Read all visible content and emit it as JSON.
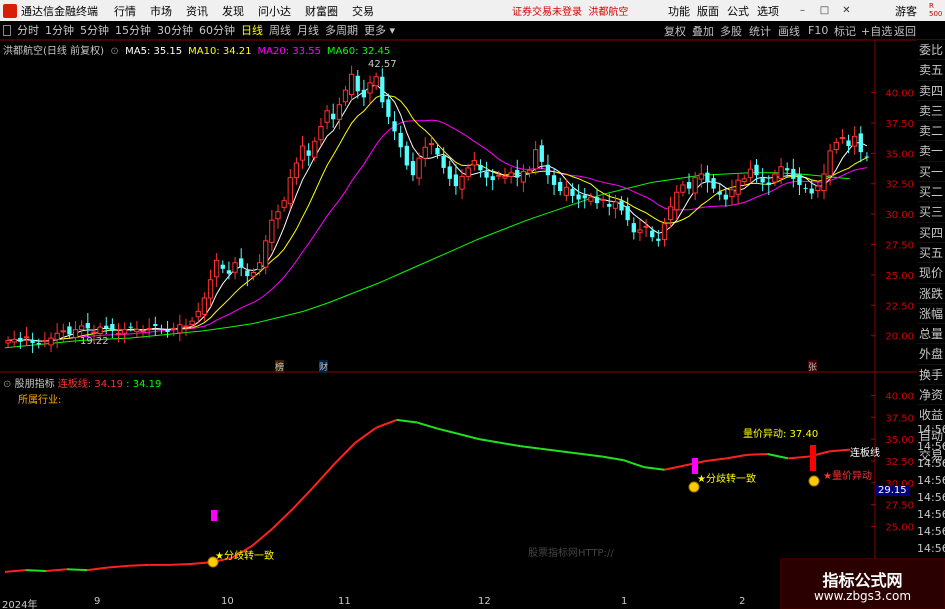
{
  "titlebar": {
    "app": "通达信金融终端",
    "menus": [
      "行情",
      "市场",
      "资讯",
      "发现",
      "问小达",
      "财富圈",
      "交易"
    ],
    "notice": "证券交易未登录",
    "stock": "洪都航空",
    "right_menus": [
      "功能",
      "版面",
      "公式",
      "选项"
    ],
    "user": "游客"
  },
  "toolbar": {
    "periods": [
      "分时",
      "1分钟",
      "5分钟",
      "15分钟",
      "30分钟",
      "60分钟",
      "日线",
      "周线",
      "月线",
      "多周期",
      "更多"
    ],
    "active_period": "日线",
    "right_buttons": [
      "复权",
      "叠加",
      "多股",
      "统计",
      "画线",
      "F10",
      "标记",
      "+自选",
      "返回"
    ]
  },
  "main": {
    "title": "洪都航空(日线 前复权)",
    "ma": [
      {
        "label": "MA5: 35.15",
        "color": "#ffffff"
      },
      {
        "label": "MA10: 34.21",
        "color": "#ffff00"
      },
      {
        "label": "MA20: 33.55",
        "color": "#ff00ff"
      },
      {
        "label": "MA60: 32.45",
        "color": "#00ff00"
      }
    ],
    "yticks": [
      "40.00",
      "37.50",
      "35.00",
      "32.50",
      "30.00",
      "27.50",
      "25.00",
      "22.50",
      "20.00"
    ],
    "high_label": "42.57",
    "low_label": "19.22",
    "markers": [
      {
        "text": "榜",
        "color": "#ffaa00"
      },
      {
        "text": "财",
        "color": "#00aaff"
      },
      {
        "text": "张",
        "color": "#ff4444"
      }
    ]
  },
  "sidebar": [
    "委比",
    "卖五",
    "卖四",
    "卖三",
    "卖二",
    "卖一",
    "买一",
    "买二",
    "买三",
    "买四",
    "买五",
    "现价",
    "涨跌",
    "涨幅",
    "总量",
    "外盘",
    "换手",
    "净资",
    "收益",
    "自动",
    "交易"
  ],
  "sidebar_times": [
    "14:56",
    "14:56",
    "14:56",
    "14:56",
    "14:56",
    "14:56",
    "14:56",
    "14:56"
  ],
  "indicator": {
    "name": "股朋指标",
    "line_label": "连板线:",
    "line_value": "34.19",
    "line_value2": ": 34.19",
    "industry": "所属行业:",
    "vol_text": "量价异动: 37.40",
    "yticks": [
      "40.00",
      "37.50",
      "35.00",
      "32.50",
      "30.00",
      "27.50",
      "25.00"
    ],
    "current_value": "29.15",
    "signals": [
      "分歧转一致",
      "分歧转一致",
      "量价异动"
    ],
    "line_tag": "连板线",
    "faint_text": "股票指标网HTTP://"
  },
  "xaxis": [
    "2024年",
    "9",
    "10",
    "11",
    "12",
    "1",
    "2"
  ],
  "watermark": {
    "title": "指标公式网",
    "url": "www.zbgs3.com"
  },
  "colors": {
    "up": "#ff3232",
    "down": "#54ffff",
    "ma5": "#ffffff",
    "ma10": "#ffff00",
    "ma20": "#ff00ff",
    "ma60": "#00ff00",
    "grid": "#7a0000"
  },
  "chart_data": {
    "type": "candlestick",
    "closes": [
      19.6,
      19.7,
      19.5,
      19.9,
      19.4,
      19.3,
      19.6,
      19.8,
      20.2,
      20.4,
      20.1,
      20.5,
      20.8,
      20.6,
      20.3,
      20.7,
      20.6,
      20.4,
      20.2,
      20.5,
      20.7,
      20.5,
      20.4,
      20.6,
      20.8,
      20.5,
      20.3,
      20.6,
      20.9,
      20.8,
      21.2,
      22.0,
      23.1,
      24.6,
      26.2,
      25.5,
      25.1,
      26.0,
      25.6,
      24.9,
      25.2,
      26.0,
      27.8,
      29.5,
      30.2,
      31.1,
      33.0,
      34.2,
      35.6,
      34.8,
      36.0,
      37.2,
      38.5,
      37.8,
      39.0,
      40.2,
      41.5,
      40.1,
      39.6,
      40.8,
      41.3,
      39.2,
      38.0,
      36.8,
      35.5,
      34.0,
      33.2,
      34.6,
      35.5,
      35.8,
      34.9,
      33.8,
      32.9,
      32.3,
      33.1,
      33.8,
      34.4,
      33.6,
      33.0,
      32.8,
      33.2,
      33.1,
      33.4,
      33.0,
      33.5,
      33.6,
      35.3,
      34.3,
      33.2,
      32.4,
      31.9,
      32.2,
      31.5,
      31.2,
      31.3,
      31.4,
      30.9,
      31.2,
      30.6,
      31.0,
      30.3,
      29.5,
      28.5,
      28.7,
      29.0,
      28.1,
      27.8,
      29.2,
      30.6,
      31.8,
      32.4,
      32.1,
      33.0,
      33.3,
      32.6,
      32.1,
      31.6,
      31.2,
      32.0,
      32.8,
      32.9,
      33.7,
      33.2,
      32.6,
      32.4,
      33.3,
      33.9,
      33.6,
      32.9,
      32.4,
      32.1,
      31.7,
      32.3,
      33.3,
      35.2,
      35.9,
      36.3,
      35.6,
      36.4,
      35.1,
      34.7
    ],
    "ma60": [
      19.0,
      19.2,
      19.4,
      19.6,
      19.7,
      19.8,
      20.0,
      20.2,
      20.4,
      20.7,
      21.0,
      21.5,
      22.0,
      22.7,
      23.5,
      24.3,
      25.2,
      26.1,
      27.0,
      27.9,
      28.7,
      29.5,
      30.2,
      30.9,
      31.6,
      32.1,
      32.6,
      32.9,
      33.2,
      33.3,
      33.4,
      33.4,
      33.3,
      33.1,
      32.9
    ],
    "indicator_line": [
      19.8,
      20.0,
      19.9,
      20.1,
      20.0,
      20.3,
      20.5,
      20.6,
      20.6,
      20.7,
      20.9,
      21.4,
      22.8,
      24.8,
      27.1,
      29.6,
      32.2,
      34.6,
      36.3,
      37.2,
      36.9,
      36.2,
      35.6,
      35.0,
      34.6,
      34.2,
      33.9,
      33.6,
      33.3,
      33.0,
      32.6,
      31.8,
      31.5,
      32.0,
      32.5,
      32.8,
      33.2,
      33.3,
      32.8,
      33.0,
      33.6,
      33.8
    ]
  }
}
